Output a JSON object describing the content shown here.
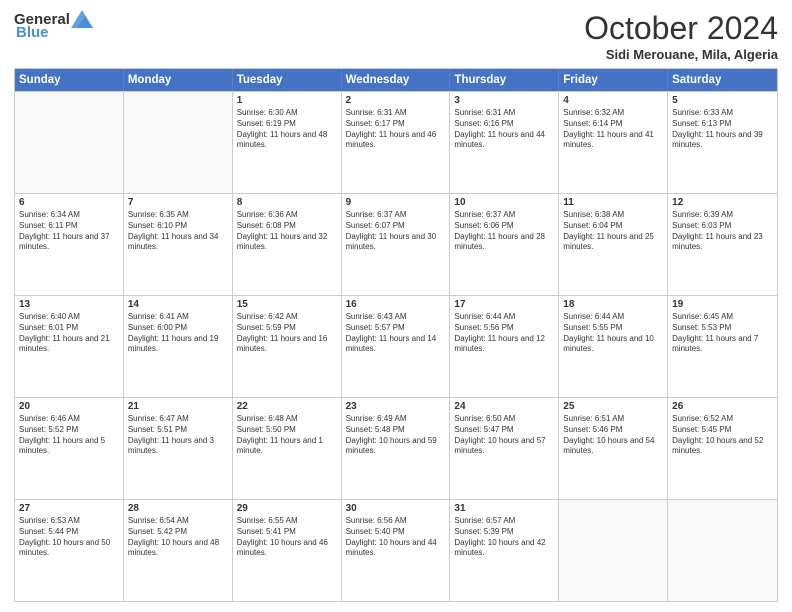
{
  "header": {
    "logo_general": "General",
    "logo_blue": "Blue",
    "month_title": "October 2024",
    "location": "Sidi Merouane, Mila, Algeria"
  },
  "days_of_week": [
    "Sunday",
    "Monday",
    "Tuesday",
    "Wednesday",
    "Thursday",
    "Friday",
    "Saturday"
  ],
  "weeks": [
    [
      {
        "day": "",
        "empty": true
      },
      {
        "day": "",
        "empty": true
      },
      {
        "day": "1",
        "sunrise": "6:30 AM",
        "sunset": "6:19 PM",
        "daylight": "11 hours and 48 minutes."
      },
      {
        "day": "2",
        "sunrise": "6:31 AM",
        "sunset": "6:17 PM",
        "daylight": "11 hours and 46 minutes."
      },
      {
        "day": "3",
        "sunrise": "6:31 AM",
        "sunset": "6:16 PM",
        "daylight": "11 hours and 44 minutes."
      },
      {
        "day": "4",
        "sunrise": "6:32 AM",
        "sunset": "6:14 PM",
        "daylight": "11 hours and 41 minutes."
      },
      {
        "day": "5",
        "sunrise": "6:33 AM",
        "sunset": "6:13 PM",
        "daylight": "11 hours and 39 minutes."
      }
    ],
    [
      {
        "day": "6",
        "sunrise": "6:34 AM",
        "sunset": "6:11 PM",
        "daylight": "11 hours and 37 minutes."
      },
      {
        "day": "7",
        "sunrise": "6:35 AM",
        "sunset": "6:10 PM",
        "daylight": "11 hours and 34 minutes."
      },
      {
        "day": "8",
        "sunrise": "6:36 AM",
        "sunset": "6:08 PM",
        "daylight": "11 hours and 32 minutes."
      },
      {
        "day": "9",
        "sunrise": "6:37 AM",
        "sunset": "6:07 PM",
        "daylight": "11 hours and 30 minutes."
      },
      {
        "day": "10",
        "sunrise": "6:37 AM",
        "sunset": "6:06 PM",
        "daylight": "11 hours and 28 minutes."
      },
      {
        "day": "11",
        "sunrise": "6:38 AM",
        "sunset": "6:04 PM",
        "daylight": "11 hours and 25 minutes."
      },
      {
        "day": "12",
        "sunrise": "6:39 AM",
        "sunset": "6:03 PM",
        "daylight": "11 hours and 23 minutes."
      }
    ],
    [
      {
        "day": "13",
        "sunrise": "6:40 AM",
        "sunset": "6:01 PM",
        "daylight": "11 hours and 21 minutes."
      },
      {
        "day": "14",
        "sunrise": "6:41 AM",
        "sunset": "6:00 PM",
        "daylight": "11 hours and 19 minutes."
      },
      {
        "day": "15",
        "sunrise": "6:42 AM",
        "sunset": "5:59 PM",
        "daylight": "11 hours and 16 minutes."
      },
      {
        "day": "16",
        "sunrise": "6:43 AM",
        "sunset": "5:57 PM",
        "daylight": "11 hours and 14 minutes."
      },
      {
        "day": "17",
        "sunrise": "6:44 AM",
        "sunset": "5:56 PM",
        "daylight": "11 hours and 12 minutes."
      },
      {
        "day": "18",
        "sunrise": "6:44 AM",
        "sunset": "5:55 PM",
        "daylight": "11 hours and 10 minutes."
      },
      {
        "day": "19",
        "sunrise": "6:45 AM",
        "sunset": "5:53 PM",
        "daylight": "11 hours and 7 minutes."
      }
    ],
    [
      {
        "day": "20",
        "sunrise": "6:46 AM",
        "sunset": "5:52 PM",
        "daylight": "11 hours and 5 minutes."
      },
      {
        "day": "21",
        "sunrise": "6:47 AM",
        "sunset": "5:51 PM",
        "daylight": "11 hours and 3 minutes."
      },
      {
        "day": "22",
        "sunrise": "6:48 AM",
        "sunset": "5:50 PM",
        "daylight": "11 hours and 1 minute."
      },
      {
        "day": "23",
        "sunrise": "6:49 AM",
        "sunset": "5:48 PM",
        "daylight": "10 hours and 59 minutes."
      },
      {
        "day": "24",
        "sunrise": "6:50 AM",
        "sunset": "5:47 PM",
        "daylight": "10 hours and 57 minutes."
      },
      {
        "day": "25",
        "sunrise": "6:51 AM",
        "sunset": "5:46 PM",
        "daylight": "10 hours and 54 minutes."
      },
      {
        "day": "26",
        "sunrise": "6:52 AM",
        "sunset": "5:45 PM",
        "daylight": "10 hours and 52 minutes."
      }
    ],
    [
      {
        "day": "27",
        "sunrise": "6:53 AM",
        "sunset": "5:44 PM",
        "daylight": "10 hours and 50 minutes."
      },
      {
        "day": "28",
        "sunrise": "6:54 AM",
        "sunset": "5:42 PM",
        "daylight": "10 hours and 48 minutes."
      },
      {
        "day": "29",
        "sunrise": "6:55 AM",
        "sunset": "5:41 PM",
        "daylight": "10 hours and 46 minutes."
      },
      {
        "day": "30",
        "sunrise": "6:56 AM",
        "sunset": "5:40 PM",
        "daylight": "10 hours and 44 minutes."
      },
      {
        "day": "31",
        "sunrise": "6:57 AM",
        "sunset": "5:39 PM",
        "daylight": "10 hours and 42 minutes."
      },
      {
        "day": "",
        "empty": true
      },
      {
        "day": "",
        "empty": true
      }
    ]
  ]
}
